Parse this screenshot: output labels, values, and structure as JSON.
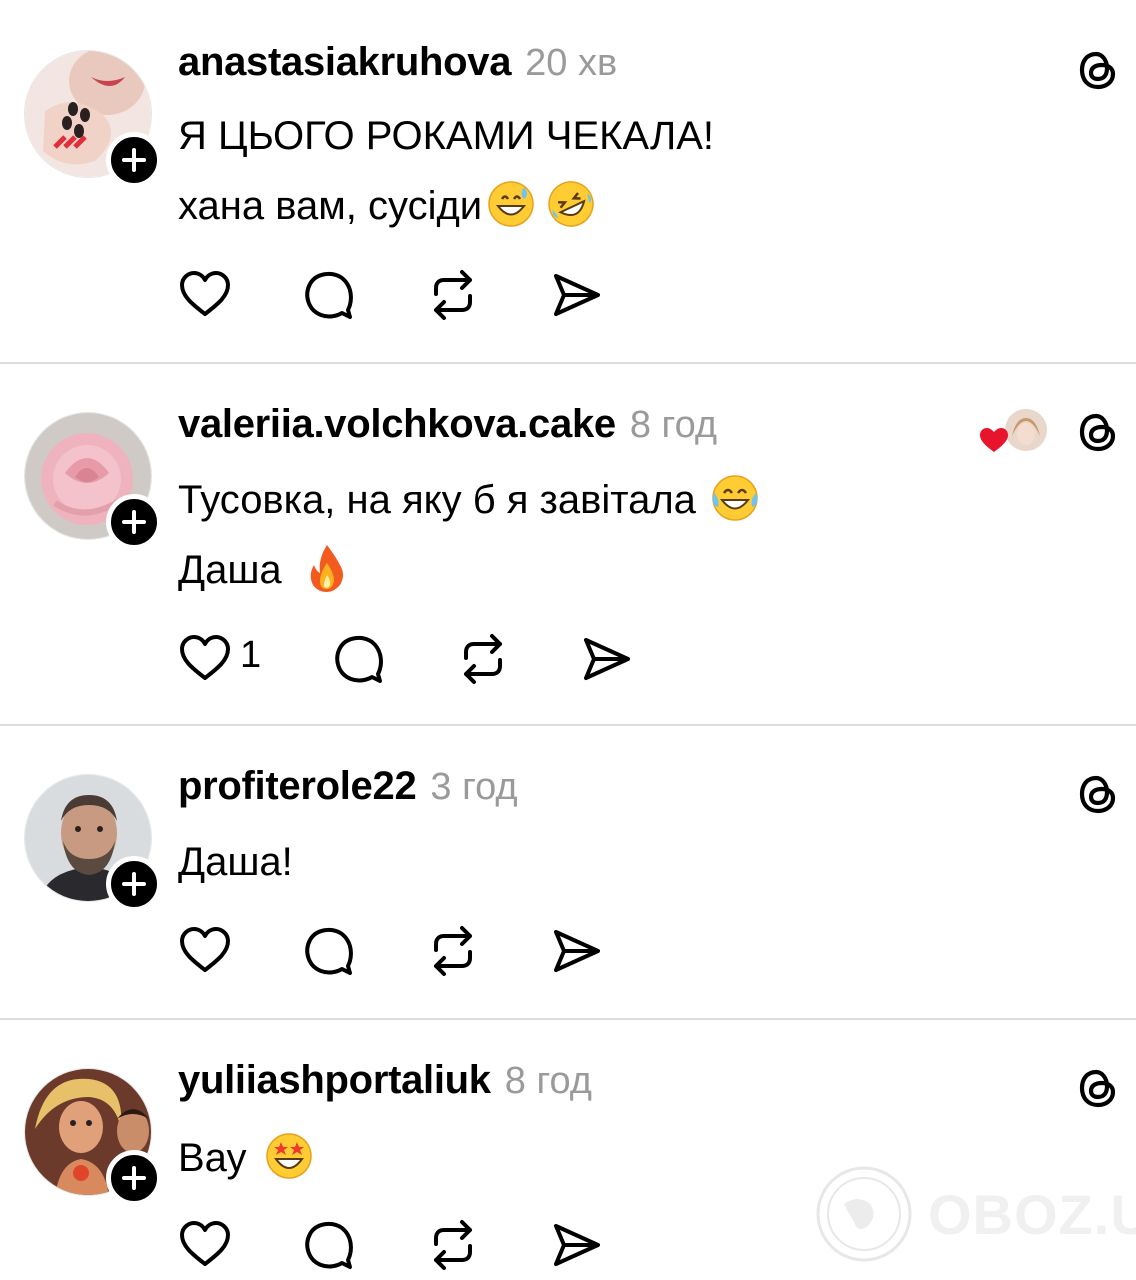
{
  "posts": [
    {
      "username": "anastasiakruhova",
      "time": "20 хв",
      "lines": [
        "Я ЦЬОГО РОКАМИ ЧЕКАЛА!",
        "хана вам, сусіди"
      ],
      "line_emojis": [
        [],
        [
          "grinning-sweat-emoji",
          "rofl-emoji"
        ]
      ],
      "likes": "",
      "avatar_icon": "avatar-hand-nails"
    },
    {
      "username": "valeriia.volchkova.cake",
      "time": "8 год",
      "lines": [
        "Тусовка, на яку б я завітала",
        "Даша"
      ],
      "line_emojis": [
        [
          "tears-of-joy-emoji"
        ],
        [
          "fire-emoji"
        ]
      ],
      "likes": "1",
      "avatar_icon": "avatar-pink-rose",
      "liked_by_icon": "liked-by-heart-avatar"
    },
    {
      "username": "profiterole22",
      "time": "3 год",
      "lines": [
        "Даша!"
      ],
      "line_emojis": [
        []
      ],
      "likes": "",
      "avatar_icon": "avatar-man-beard"
    },
    {
      "username": "yuliiashportaliuk",
      "time": "8 год",
      "lines": [
        "Вау"
      ],
      "line_emojis": [
        [
          "star-struck-emoji"
        ]
      ],
      "likes": "",
      "avatar_icon": "avatar-dolls"
    }
  ],
  "icons": {
    "follow": "plus-icon",
    "like": "heart-icon",
    "reply": "comment-bubble-icon",
    "repost": "repost-icon",
    "share": "send-icon",
    "app": "threads-logo-icon"
  },
  "watermark": {
    "text": "OBOZ.UA"
  },
  "colors": {
    "time": "#9a9a9a",
    "divider": "#dcdcdc",
    "heart": "#e8132d"
  }
}
